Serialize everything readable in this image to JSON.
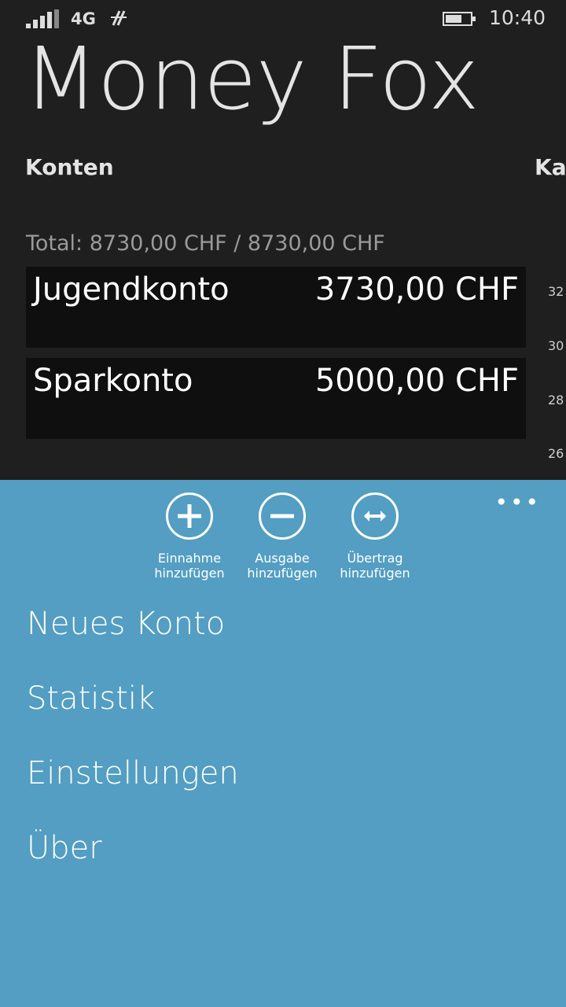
{
  "status": {
    "network": "4G",
    "time": "10:40"
  },
  "app": {
    "title": "Money Fox"
  },
  "pivot": {
    "current": "Konten",
    "next": "Kap"
  },
  "total": "Total: 8730,00 CHF / 8730,00 CHF",
  "accounts": [
    {
      "name": "Jugendkonto",
      "amount": "3730,00 CHF"
    },
    {
      "name": "Sparkonto",
      "amount": "5000,00 CHF"
    }
  ],
  "chart_ticks": [
    "32",
    "30",
    "28",
    "26"
  ],
  "appbar": {
    "more": "•••",
    "buttons": [
      {
        "icon": "plus-circle-icon",
        "line1": "Einnahme",
        "line2": "hinzufügen"
      },
      {
        "icon": "minus-circle-icon",
        "line1": "Ausgabe",
        "line2": "hinzufügen"
      },
      {
        "icon": "transfer-circle-icon",
        "line1": "Übertrag",
        "line2": "hinzufügen"
      }
    ],
    "menu": [
      "Neues Konto",
      "Statistik",
      "Einstellungen",
      "Über"
    ]
  },
  "colors": {
    "appbar": "#539ec2",
    "background": "#1f1f1f",
    "card": "#0f0f0f"
  }
}
